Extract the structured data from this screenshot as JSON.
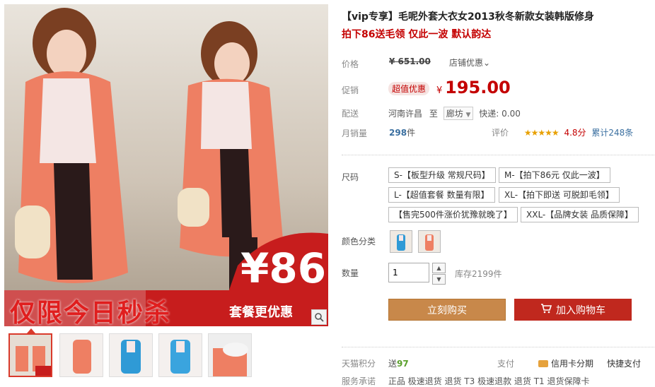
{
  "product": {
    "title": "【vip专享】毛呢外套大衣女2013秋冬新款女装韩版修身",
    "subtitle": "拍下86送毛领 仅此一波 默认韵达"
  },
  "banner": {
    "price_text": "¥86",
    "slogan_text": "仅限今日秒杀",
    "combo_text": "套餐更优惠"
  },
  "price": {
    "label": "价格",
    "original": "¥ 651.00",
    "shop_deal": "店铺优惠⌄"
  },
  "promo": {
    "label": "促销",
    "badge": "超值优惠",
    "currency": "¥",
    "value": "195.00"
  },
  "shipping": {
    "label": "配送",
    "from": "河南许昌",
    "to_word": "至",
    "dest": "廊坊",
    "fee": "快递: 0.00"
  },
  "sales": {
    "label": "月销量",
    "count": "298",
    "unit": "件"
  },
  "rating": {
    "label": "评价",
    "stars": "★★★★★",
    "score": "4.8分",
    "total": "累计248条"
  },
  "size": {
    "label": "尺码",
    "options": [
      "S-【板型升级 常规尺码】",
      "M-【拍下86元 仅此一波】",
      "L-【超值套餐 数量有限】",
      "XL-【拍下即送 可脱卸毛领】",
      "【售完500件涨价犹豫就晚了】",
      "XXL-【品牌女装 品质保障】"
    ]
  },
  "color": {
    "label": "颜色分类"
  },
  "quantity": {
    "label": "数量",
    "value": "1",
    "stock": "库存2199件"
  },
  "actions": {
    "buy": "立刻购买",
    "cart": "加入购物车"
  },
  "footer": {
    "points_label": "天猫积分",
    "points_prefix": "送",
    "points_value": "97",
    "pay_label": "支付",
    "credit": "信用卡分期",
    "quick": "快捷支付",
    "service_label": "服务承诺",
    "service_text": "正品 极速退货 退货 T3 极速退款 退货 T1 退货保障卡"
  },
  "icons": {
    "zoom": "magnifier-icon",
    "cart": "cart-icon",
    "credit": "credit-card-icon"
  },
  "colors": {
    "accent_red": "#c40000",
    "buy_button": "#c8884a",
    "cart_button": "#c0281e"
  }
}
